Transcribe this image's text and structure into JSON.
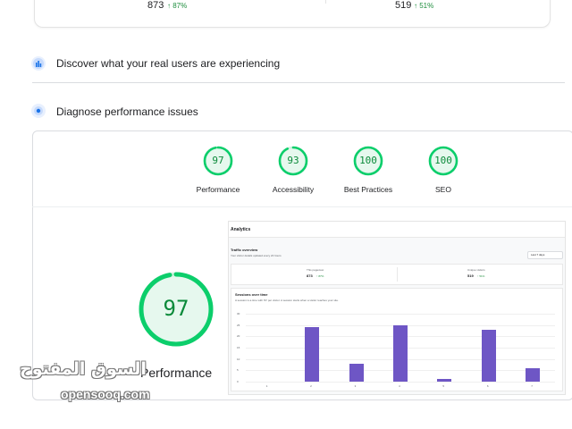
{
  "traffic_stats": [
    {
      "value": "873",
      "delta": "↑ 87%"
    },
    {
      "value": "519",
      "delta": "↑ 51%"
    }
  ],
  "sections": {
    "discover": "Discover what your real users are experiencing",
    "diagnose": "Diagnose performance issues"
  },
  "scores": [
    {
      "value": "97",
      "label": "Performance",
      "fraction": 0.97
    },
    {
      "value": "93",
      "label": "Accessibility",
      "fraction": 0.93
    },
    {
      "value": "100",
      "label": "Best Practices",
      "fraction": 1.0
    },
    {
      "value": "100",
      "label": "SEO",
      "fraction": 1.0
    }
  ],
  "main_score": {
    "value": "97",
    "label": "Performance",
    "fraction": 0.97
  },
  "colors": {
    "pass": "#0cce6b",
    "pass_text": "#0b8a3a",
    "bar": "#6e56c5",
    "accent_blue": "#1a73e8"
  },
  "screenshot": {
    "title": "Analytics",
    "overview_title": "Traffic overview",
    "overview_subtitle": "Your visitor details updated every 24 hours",
    "select_value": "Last 7 days",
    "stat_left": {
      "label": "This pageview",
      "value": "873",
      "delta": "↑ 87%"
    },
    "stat_right": {
      "label": "Unique visitors",
      "value": "519",
      "delta": "↑ 51%"
    },
    "chart_title": "Sessions over time",
    "chart_subtitle": "A session is a time with 'ID' per visitor. A session starts when a visitor reaches your site.",
    "chart_data": {
      "type": "bar",
      "categories": [
        "1",
        "2",
        "3",
        "4",
        "5",
        "6",
        "7"
      ],
      "values": [
        0,
        24,
        8,
        25,
        1,
        23,
        6
      ],
      "ylim": [
        0,
        30
      ],
      "y_ticks": [
        "0",
        "5",
        "10",
        "15",
        "20",
        "25",
        "30"
      ]
    }
  },
  "watermark": {
    "arabic": "السوق المفتوح",
    "latin": "opensooq.com"
  }
}
